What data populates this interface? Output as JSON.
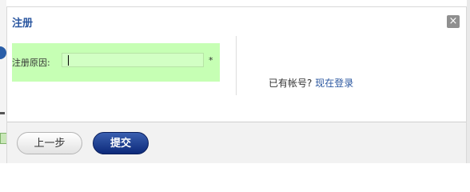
{
  "dialog": {
    "title": "注册",
    "close_label": "×"
  },
  "form": {
    "reason_label": "注册原因:",
    "reason_value": "",
    "required_mark": "*"
  },
  "login": {
    "prompt": "已有帐号?",
    "link": "现在登录"
  },
  "footer": {
    "prev_label": "上一步",
    "submit_label": "提交"
  },
  "colors": {
    "accent": "#2b57a0",
    "form_highlight": "#c6ffb4",
    "submit_button": "#0d2a7a"
  }
}
